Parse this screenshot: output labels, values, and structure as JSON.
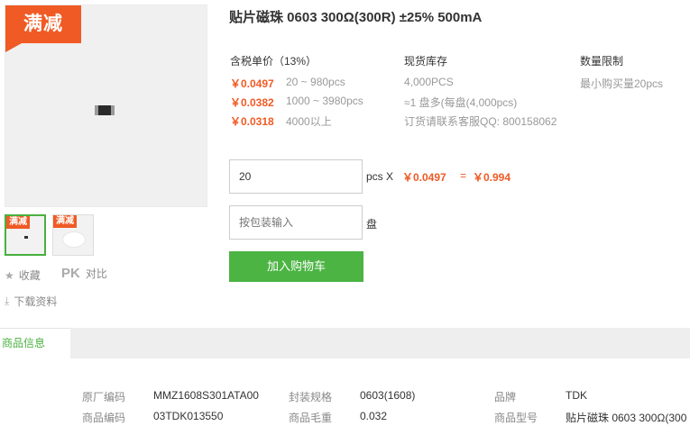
{
  "product": {
    "badge": "满减",
    "title": "贴片磁珠 0603 300Ω(300R) ±25% 500mA"
  },
  "thumbnails": [
    {
      "badge": "满减"
    },
    {
      "badge": "满减"
    }
  ],
  "side_actions": {
    "favorite": "收藏",
    "pk": "PK",
    "compare": "对比",
    "download": "下载资料"
  },
  "pricing": {
    "header": "含税单价（13%）",
    "tiers": [
      {
        "price": "￥0.0497",
        "range": "20 ~ 980pcs"
      },
      {
        "price": "￥0.0382",
        "range": "1000 ~ 3980pcs"
      },
      {
        "price": "￥0.0318",
        "range": "4000以上"
      }
    ]
  },
  "stock": {
    "header": "现货库存",
    "quantity": "4,000PCS",
    "reel": "≈1 盘多(每盘(4,000pcs)",
    "contact": "订货请联系客服QQ: 800158062"
  },
  "limit": {
    "header": "数量限制",
    "min": "最小购买量20pcs"
  },
  "order": {
    "qty_value": "20",
    "unit": "pcs X",
    "unit_price": "￥0.0497",
    "equals": "=",
    "total": "￥0.994",
    "reel_placeholder": "按包装输入",
    "reel_unit": "盘",
    "cart_button": "加入购物车"
  },
  "tabs": {
    "info": "商品信息"
  },
  "specs": [
    {
      "label": "原厂编码",
      "value": "MMZ1608S301ATA00"
    },
    {
      "label": "封装规格",
      "value": "0603(1608)"
    },
    {
      "label": "品牌",
      "value": "TDK"
    },
    {
      "label": "商品编码",
      "value": "03TDK013550"
    },
    {
      "label": "商品毛重",
      "value": "0.032"
    },
    {
      "label": "商品型号",
      "value": "贴片磁珠 0603 300Ω(300."
    }
  ],
  "colors": {
    "accent_orange": "#f05a24",
    "accent_green": "#4cb443"
  }
}
